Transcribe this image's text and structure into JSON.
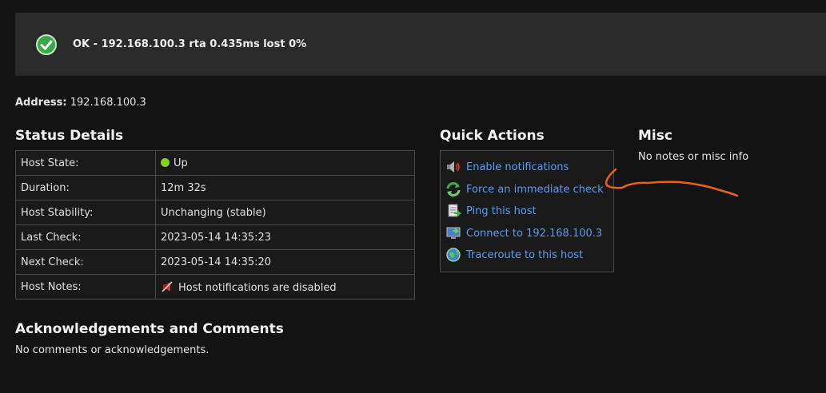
{
  "banner": {
    "status_text": "OK - 192.168.100.3 rta 0.435ms lost 0%",
    "icon": "ok-check-icon"
  },
  "address": {
    "label": "Address:",
    "value": "192.168.100.3"
  },
  "status_details": {
    "title": "Status Details",
    "rows": [
      {
        "key": "Host State:",
        "value": "Up"
      },
      {
        "key": "Duration:",
        "value": "12m 32s"
      },
      {
        "key": "Host Stability:",
        "value": "Unchanging (stable)"
      },
      {
        "key": "Last Check:",
        "value": "2023-05-14 14:35:23"
      },
      {
        "key": "Next Check:",
        "value": "2023-05-14 14:35:20"
      },
      {
        "key": "Host Notes:",
        "value": "Host notifications are disabled"
      }
    ]
  },
  "quick_actions": {
    "title": "Quick Actions",
    "items": [
      {
        "label": "Enable notifications",
        "icon": "speaker-icon"
      },
      {
        "label": "Force an immediate check",
        "icon": "refresh-icon"
      },
      {
        "label": "Ping this host",
        "icon": "ping-icon"
      },
      {
        "label": "Connect to 192.168.100.3",
        "icon": "monitor-icon"
      },
      {
        "label": "Traceroute to this host",
        "icon": "globe-icon"
      }
    ]
  },
  "misc": {
    "title": "Misc",
    "text": "No notes or misc info"
  },
  "ack": {
    "title": "Acknowledgements and Comments",
    "text": "No comments or acknowledgements."
  },
  "colors": {
    "link": "#5b9cf5",
    "up": "#7ed321",
    "annotation": "#e8621c"
  }
}
